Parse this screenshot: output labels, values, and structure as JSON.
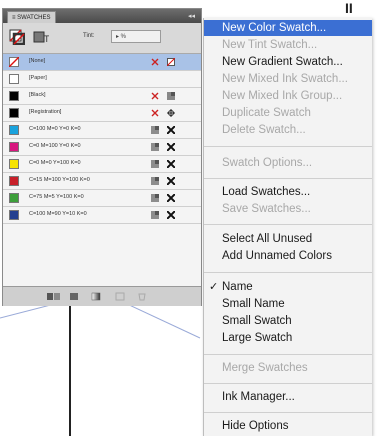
{
  "panel": {
    "tab_label": "≡ SWATCHES",
    "collapse_glyph": "◂◂",
    "tint_label": "Tint:",
    "tint_value": "▸ %",
    "swatches": [
      {
        "name": "[None]",
        "color": "#ffffff",
        "selected": true
      },
      {
        "name": "[Paper]",
        "color": "#ffffff",
        "selected": false
      },
      {
        "name": "[Black]",
        "color": "#000000",
        "selected": false
      },
      {
        "name": "[Registration]",
        "color": "#000000",
        "selected": false
      },
      {
        "name": "C=100 M=0 Y=0 K=0",
        "color": "#1aa3dd",
        "selected": false
      },
      {
        "name": "C=0 M=100 Y=0 K=0",
        "color": "#d8177f",
        "selected": false
      },
      {
        "name": "C=0 M=0 Y=100 K=0",
        "color": "#f6e200",
        "selected": false
      },
      {
        "name": "C=15 M=100 Y=100 K=0",
        "color": "#c8202a",
        "selected": false
      },
      {
        "name": "C=75 M=5 Y=100 K=0",
        "color": "#3d9f3a",
        "selected": false
      },
      {
        "name": "C=100 M=90 Y=10 K=0",
        "color": "#24408f",
        "selected": false
      }
    ]
  },
  "menu": {
    "items": [
      {
        "label": "New Color Swatch...",
        "disabled": false,
        "highlighted": true
      },
      {
        "label": "New Tint Swatch...",
        "disabled": true
      },
      {
        "label": "New Gradient Swatch...",
        "disabled": false
      },
      {
        "label": "New Mixed Ink Swatch...",
        "disabled": true
      },
      {
        "label": "New Mixed Ink Group...",
        "disabled": true
      },
      {
        "label": "Duplicate Swatch",
        "disabled": true
      },
      {
        "label": "Delete Swatch...",
        "disabled": true
      },
      {
        "label": "Swatch Options...",
        "disabled": true
      },
      {
        "label": "Load Swatches...",
        "disabled": false
      },
      {
        "label": "Save Swatches...",
        "disabled": true
      },
      {
        "label": "Select All Unused",
        "disabled": false
      },
      {
        "label": "Add Unnamed Colors",
        "disabled": false
      },
      {
        "label": "Name",
        "disabled": false,
        "checked": true
      },
      {
        "label": "Small Name",
        "disabled": false
      },
      {
        "label": "Small Swatch",
        "disabled": false
      },
      {
        "label": "Large Swatch",
        "disabled": false
      },
      {
        "label": "Merge Swatches",
        "disabled": true
      },
      {
        "label": "Ink Manager...",
        "disabled": false
      },
      {
        "label": "Hide Options",
        "disabled": false
      }
    ],
    "checkmark": "✓"
  },
  "top_glyph": "II",
  "colors": {
    "highlight": "#3b6fd3",
    "selection": "#a9c2e7"
  }
}
